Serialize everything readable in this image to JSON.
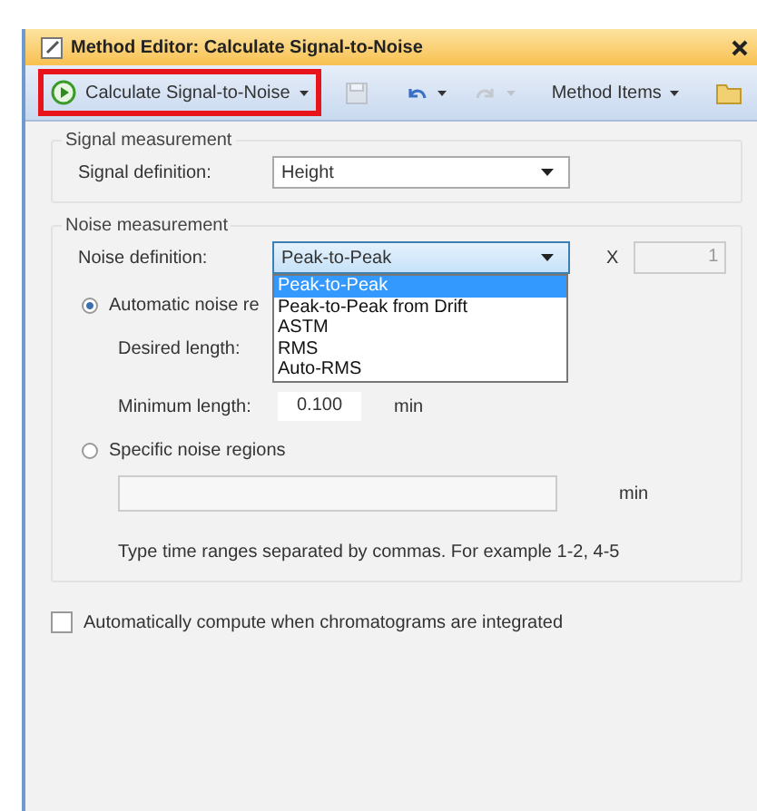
{
  "window": {
    "title": "Method Editor: Calculate Signal-to-Noise"
  },
  "toolbar": [
    {
      "kind": "button",
      "label": "Calculate Signal-to-Noise",
      "caret": true,
      "highlighted": true,
      "disabled": false
    },
    {
      "kind": "separator"
    },
    {
      "kind": "button",
      "caret": false,
      "highlighted": false,
      "disabled": true
    },
    {
      "kind": "separator"
    },
    {
      "kind": "button",
      "caret": true,
      "highlighted": false,
      "disabled": false
    },
    {
      "kind": "button",
      "caret": true,
      "highlighted": false,
      "disabled": true
    },
    {
      "kind": "separator"
    },
    {
      "kind": "button",
      "label": "Method Items",
      "caret": true,
      "highlighted": false,
      "disabled": false
    },
    {
      "kind": "separator"
    },
    {
      "kind": "button",
      "caret": false,
      "highlighted": false,
      "disabled": false
    }
  ],
  "signal_measurement": {
    "title": "Signal measurement",
    "label": "Signal definition:",
    "value": "Height"
  },
  "noise_measurement": {
    "title": "Noise measurement",
    "label": "Noise definition:",
    "value": "Peak-to-Peak",
    "expanded": true,
    "options": [
      {
        "label": "Peak-to-Peak",
        "selected": true
      },
      {
        "label": "Peak-to-Peak from Drift",
        "selected": false
      },
      {
        "label": "ASTM",
        "selected": false
      },
      {
        "label": "RMS",
        "selected": false
      },
      {
        "label": "Auto-RMS",
        "selected": false
      }
    ],
    "multiplier_label": "X",
    "multiplier_value": "1",
    "automatic": {
      "label": "Automatic noise re",
      "selected": true,
      "desired_label": "Desired length:",
      "minimum_label": "Minimum length:",
      "minimum_value": "0.100",
      "minimum_unit": "min"
    },
    "specific": {
      "label": "Specific noise regions",
      "selected": false,
      "unit": "min",
      "hint": "Type time ranges separated by commas. For example 1-2, 4-5"
    }
  },
  "auto_compute": {
    "label": "Automatically compute when chromatograms are integrated",
    "checked": false
  }
}
